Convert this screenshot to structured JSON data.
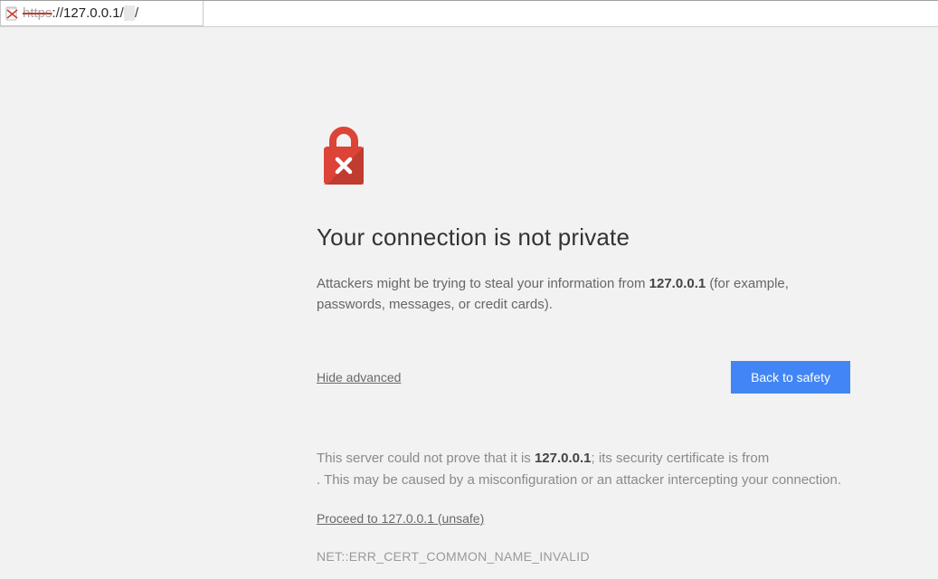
{
  "address_bar": {
    "scheme_label": "https",
    "scheme_sep": "://",
    "host": "127.0.0.1",
    "sep1": "/",
    "redacted": "        ",
    "sep2": "/"
  },
  "warning": {
    "title": "Your connection is not private",
    "subtext_pre": "Attackers might be trying to steal your information from ",
    "subtext_host": "127.0.0.1",
    "subtext_post": " (for example, passwords, messages, or credit cards).",
    "hide_advanced": "Hide advanced",
    "back_to_safety": "Back to safety",
    "advanced_pre": "This server could not prove that it is ",
    "advanced_host": "127.0.0.1",
    "advanced_mid": "; its security certificate is from ",
    "advanced_redacted1": "      ",
    "advanced_redacted2": "                              ",
    "advanced_post": ". This may be caused by a misconfiguration or an attacker intercepting your connection.",
    "proceed": "Proceed to 127.0.0.1 (unsafe)",
    "error_code": "NET::ERR_CERT_COMMON_NAME_INVALID"
  }
}
